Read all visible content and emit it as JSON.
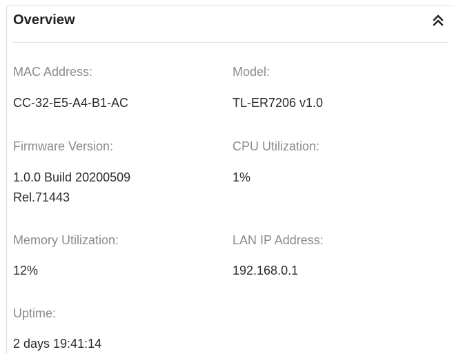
{
  "overview": {
    "title": "Overview",
    "collapse_icon": "double-chevron-up-icon",
    "fields": {
      "mac": {
        "label": "MAC Address:",
        "value": "CC-32-E5-A4-B1-AC"
      },
      "model": {
        "label": "Model:",
        "value": "TL-ER7206 v1.0"
      },
      "firmware": {
        "label": "Firmware Version:",
        "value_line1": "1.0.0 Build 20200509",
        "value_line2": "Rel.71443"
      },
      "cpu": {
        "label": "CPU Utilization:",
        "value": "1%"
      },
      "memory": {
        "label": "Memory Utilization:",
        "value": "12%"
      },
      "lan_ip": {
        "label": "LAN IP Address:",
        "value": "192.168.0.1"
      },
      "uptime": {
        "label": "Uptime:",
        "value": "2 days 19:41:14"
      }
    }
  }
}
